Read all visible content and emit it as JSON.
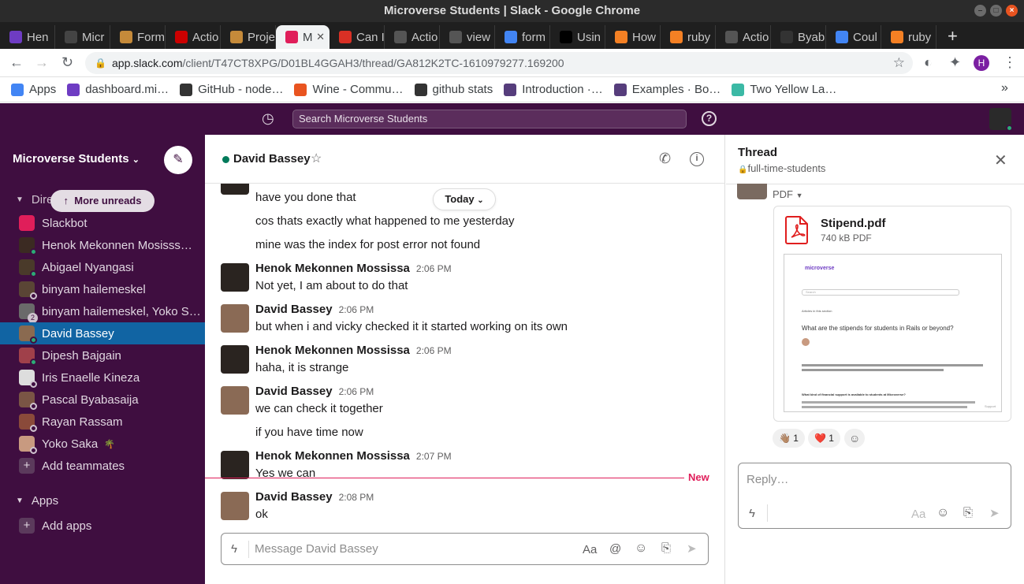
{
  "window_title": "Microverse Students | Slack - Google Chrome",
  "tabs": [
    {
      "label": "Hen",
      "icon": "microverse-icon",
      "color": "#6e3cc3"
    },
    {
      "label": "Micr",
      "icon": "microverse-icon",
      "color": "#444"
    },
    {
      "label": "Form",
      "icon": "owl-icon",
      "color": "#c58a3a"
    },
    {
      "label": "Actio",
      "icon": "rails-icon",
      "color": "#cc0000"
    },
    {
      "label": "Proje",
      "icon": "owl-icon",
      "color": "#c58a3a"
    },
    {
      "label": "M",
      "icon": "slack-icon",
      "color": "#e01e5a",
      "active": true
    },
    {
      "label": "Can I",
      "icon": "gmail-icon",
      "color": "#d93025"
    },
    {
      "label": "Actio",
      "icon": "globe-icon",
      "color": "#555"
    },
    {
      "label": "view",
      "icon": "globe-icon",
      "color": "#555"
    },
    {
      "label": "form",
      "icon": "google-icon",
      "color": "#4285f4"
    },
    {
      "label": "Usin",
      "icon": "medium-icon",
      "color": "#000"
    },
    {
      "label": "How",
      "icon": "stackoverflow-icon",
      "color": "#f48024"
    },
    {
      "label": "ruby",
      "icon": "stackoverflow-icon",
      "color": "#f48024"
    },
    {
      "label": "Actio",
      "icon": "globe-icon",
      "color": "#555"
    },
    {
      "label": "Byab",
      "icon": "github-icon",
      "color": "#333"
    },
    {
      "label": "Coul",
      "icon": "google-icon",
      "color": "#4285f4"
    },
    {
      "label": "ruby",
      "icon": "stackoverflow-icon",
      "color": "#f48024"
    }
  ],
  "new_tab_icon": "+",
  "address": {
    "domain": "app.slack.com",
    "path": "/client/T47CT8XPG/D01BL4GGAH3/thread/GA812K2TC-1610979277.169200"
  },
  "profile_initial": "H",
  "bookmarks": [
    {
      "label": "Apps",
      "icon": "apps-grid-icon",
      "color": "#4285f4"
    },
    {
      "label": "dashboard.mi…",
      "icon": "microverse-icon",
      "color": "#6e3cc3"
    },
    {
      "label": "GitHub - node…",
      "icon": "github-icon",
      "color": "#333"
    },
    {
      "label": "Wine - Commu…",
      "icon": "ubuntu-icon",
      "color": "#e95420"
    },
    {
      "label": "github stats",
      "icon": "github-icon",
      "color": "#333"
    },
    {
      "label": "Introduction ·…",
      "icon": "bootstrap-icon",
      "color": "#563d7c"
    },
    {
      "label": "Examples · Bo…",
      "icon": "bootstrap-icon",
      "color": "#563d7c"
    },
    {
      "label": "Two Yellow La…",
      "icon": "tyl-icon",
      "color": "#3bb9a5"
    }
  ],
  "search_placeholder": "Search Microverse Students",
  "workspace": "Microverse Students",
  "more_unreads": "More unreads",
  "dm_section": "Dire",
  "dms": [
    {
      "name": "Slackbot",
      "color": "#e01e5a",
      "presence": "none"
    },
    {
      "name": "Henok Mekonnen Mosisss…",
      "color": "#3b2a22",
      "presence": "on"
    },
    {
      "name": "Abigael Nyangasi",
      "color": "#4a3a2a",
      "presence": "on"
    },
    {
      "name": "binyam hailemeskel",
      "color": "#5a4535",
      "presence": "off"
    },
    {
      "name": "binyam hailemeskel, Yoko S…",
      "color": "#6a6a6a",
      "presence": "count",
      "count": "2"
    },
    {
      "name": "David Bassey",
      "color": "#8a6a50",
      "presence": "on",
      "selected": true
    },
    {
      "name": "Dipesh Bajgain",
      "color": "#a0404a",
      "presence": "on"
    },
    {
      "name": "Iris Enaelle Kineza",
      "color": "#ddd",
      "presence": "off"
    },
    {
      "name": "Pascal Byabasaija",
      "color": "#7a5545",
      "presence": "off"
    },
    {
      "name": "Rayan Rassam",
      "color": "#8a4a3a",
      "presence": "off"
    },
    {
      "name": "Yoko Saka",
      "color": "#c89a80",
      "presence": "off",
      "emoji": "🌴"
    }
  ],
  "add_teammates": "Add teammates",
  "apps_section": "Apps",
  "add_apps": "Add apps",
  "chat": {
    "title": "David Bassey",
    "today_label": "Today",
    "new_label": "New",
    "message_placeholder": "Message David Bassey",
    "messages": [
      {
        "text": "have you done that"
      },
      {
        "text": "cos thats exactly what happened to me yesterday"
      },
      {
        "text": "mine was the index for post error not found"
      },
      {
        "author": "Henok Mekonnen Mossissa",
        "time": "2:06 PM",
        "text": "Not yet, I am about to do that"
      },
      {
        "author": "David Bassey",
        "time": "2:06 PM",
        "text": "but when i and vicky checked it it started working on its own"
      },
      {
        "author": "Henok Mekonnen Mossissa",
        "time": "2:06 PM",
        "text": "haha, it is strange"
      },
      {
        "author": "David Bassey",
        "time": "2:06 PM",
        "text": "we can check it together"
      },
      {
        "text": "if you have time now"
      },
      {
        "author": "Henok Mekonnen Mossissa",
        "time": "2:07 PM",
        "text": "Yes we can"
      },
      {
        "author": "David Bassey",
        "time": "2:08 PM",
        "text": "ok"
      }
    ]
  },
  "thread": {
    "title": "Thread",
    "channel": "full-time-students",
    "pdf_label": "PDF",
    "file_name": "Stipend.pdf",
    "file_meta": "740 kB PDF",
    "preview_brand": "microverse",
    "preview_heading": "What are the stipends for students in Rails or beyond?",
    "preview_search": "Search",
    "preview_section": "Articles in this section",
    "preview_subheading": "What kind of financial support is available to students at Microverse?",
    "preview_support": "Support",
    "reactions": [
      {
        "emoji": "👋🏽",
        "count": "1"
      },
      {
        "emoji": "❤️",
        "count": "1"
      }
    ],
    "reply_placeholder": "Reply…"
  },
  "composer_format_label": "Aa"
}
